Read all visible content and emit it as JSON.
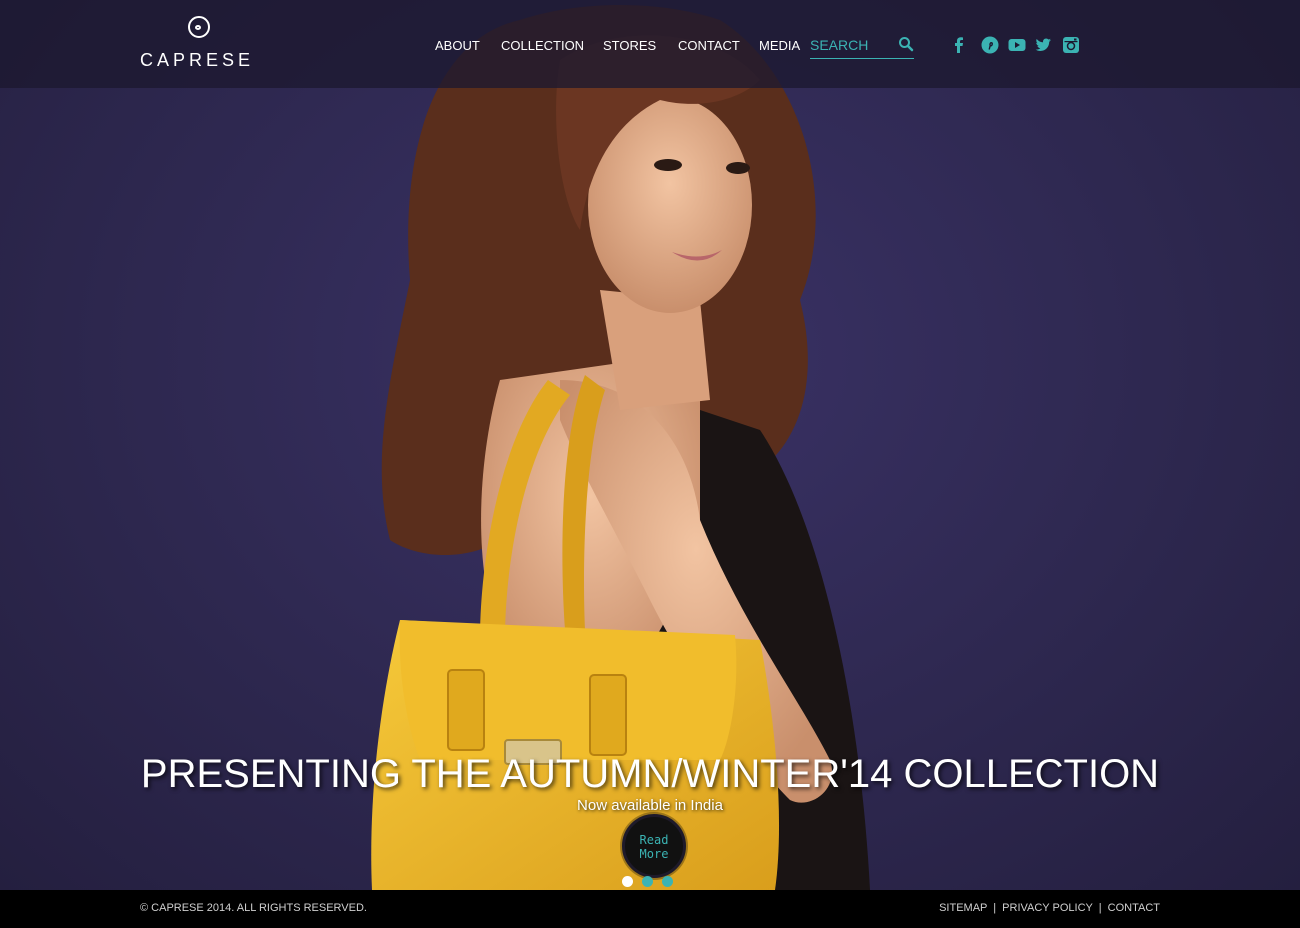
{
  "brand": {
    "name": "CAPRESE"
  },
  "nav": {
    "items": [
      {
        "label": "ABOUT"
      },
      {
        "label": "COLLECTION"
      },
      {
        "label": "STORES"
      },
      {
        "label": "CONTACT"
      },
      {
        "label": "MEDIA"
      }
    ],
    "search_placeholder": "SEARCH"
  },
  "social": [
    "facebook-icon",
    "pinterest-icon",
    "youtube-icon",
    "twitter-icon",
    "instagram-icon"
  ],
  "hero": {
    "title": "PRESENTING THE AUTUMN/WINTER'14 COLLECTION",
    "subtitle": "Now available in India",
    "read_more_line1": "Read",
    "read_more_line2": "More",
    "slides": 3,
    "active_slide": 1
  },
  "footer": {
    "copyright": "© CAPRESE 2014. ALL RIGHTS RESERVED.",
    "links": [
      "SITEMAP",
      "PRIVACY POLICY",
      "CONTACT"
    ],
    "separator": "|"
  },
  "colors": {
    "accent": "#3bb3b3",
    "background": "#2e2850",
    "bag": "#e8b52a",
    "footer": "#000000"
  }
}
